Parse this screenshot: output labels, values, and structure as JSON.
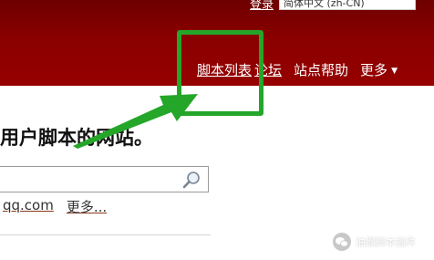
{
  "header": {
    "login_label": "登录",
    "language_selected": "简体中文 (zh-CN)",
    "nav": [
      "脚本列表",
      "论坛",
      "站点帮助",
      "更多"
    ],
    "more_caret": "▼"
  },
  "main": {
    "tagline": "用户脚本的网站。",
    "search": {
      "value": "",
      "placeholder": ""
    },
    "site_links": [
      "qq.com",
      "更多..."
    ]
  },
  "watermark": {
    "text": "油猴脚本插件"
  },
  "colors": {
    "header": "#8a0000",
    "annotation": "#24a629"
  }
}
